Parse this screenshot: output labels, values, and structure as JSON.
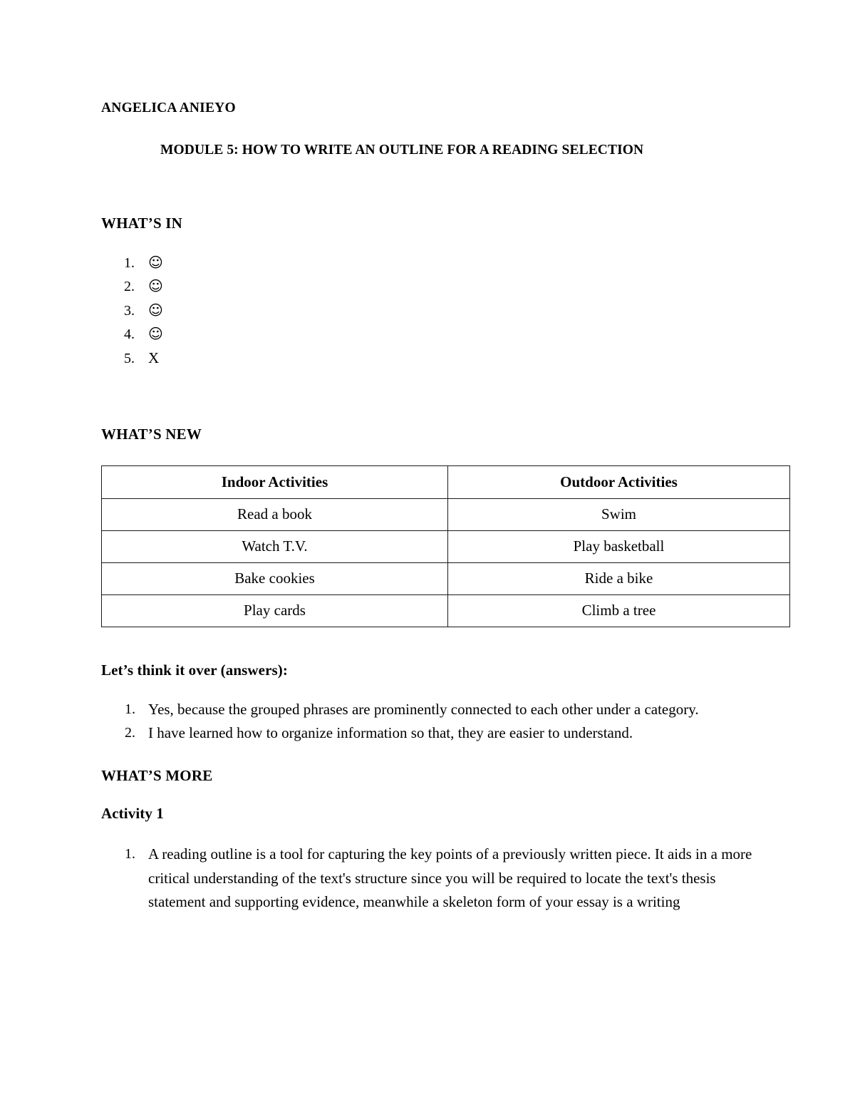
{
  "document": {
    "author": "ANGELICA ANIEYO",
    "module_title": "MODULE 5: HOW TO WRITE AN OUTLINE FOR A READING SELECTION"
  },
  "whats_in": {
    "heading": "WHAT’S IN",
    "items": [
      {
        "number": "1.",
        "symbol": "☺",
        "kind": "smiley"
      },
      {
        "number": "2.",
        "symbol": "☺",
        "kind": "smiley"
      },
      {
        "number": "3.",
        "symbol": "☺",
        "kind": "smiley"
      },
      {
        "number": "4.",
        "symbol": "☺",
        "kind": "smiley"
      },
      {
        "number": "5.",
        "symbol": "X",
        "kind": "letter"
      }
    ]
  },
  "whats_new": {
    "heading": "WHAT’S NEW",
    "table": {
      "headers": [
        "Indoor Activities",
        "Outdoor Activities"
      ],
      "rows": [
        [
          "Read a book",
          "Swim"
        ],
        [
          "Watch T.V.",
          "Play basketball"
        ],
        [
          "Bake cookies",
          "Ride a bike"
        ],
        [
          "Play cards",
          "Climb a tree"
        ]
      ]
    }
  },
  "think_it_over": {
    "heading": "Let’s think it over (answers):",
    "answers": [
      {
        "number": "1.",
        "text": "Yes, because the grouped phrases are prominently connected to each other under a category."
      },
      {
        "number": "2.",
        "text": "I have learned how to organize information so that, they are easier to understand."
      }
    ]
  },
  "whats_more": {
    "heading": "WHAT’S MORE",
    "activity_heading": "Activity 1",
    "items": [
      {
        "number": "1.",
        "text": "A reading outline is a tool for capturing the key points of a previously written piece. It aids in a more critical understanding of the text's structure since you will be required to locate the text's thesis statement and supporting evidence, meanwhile a skeleton form of your essay is a writing"
      }
    ]
  }
}
